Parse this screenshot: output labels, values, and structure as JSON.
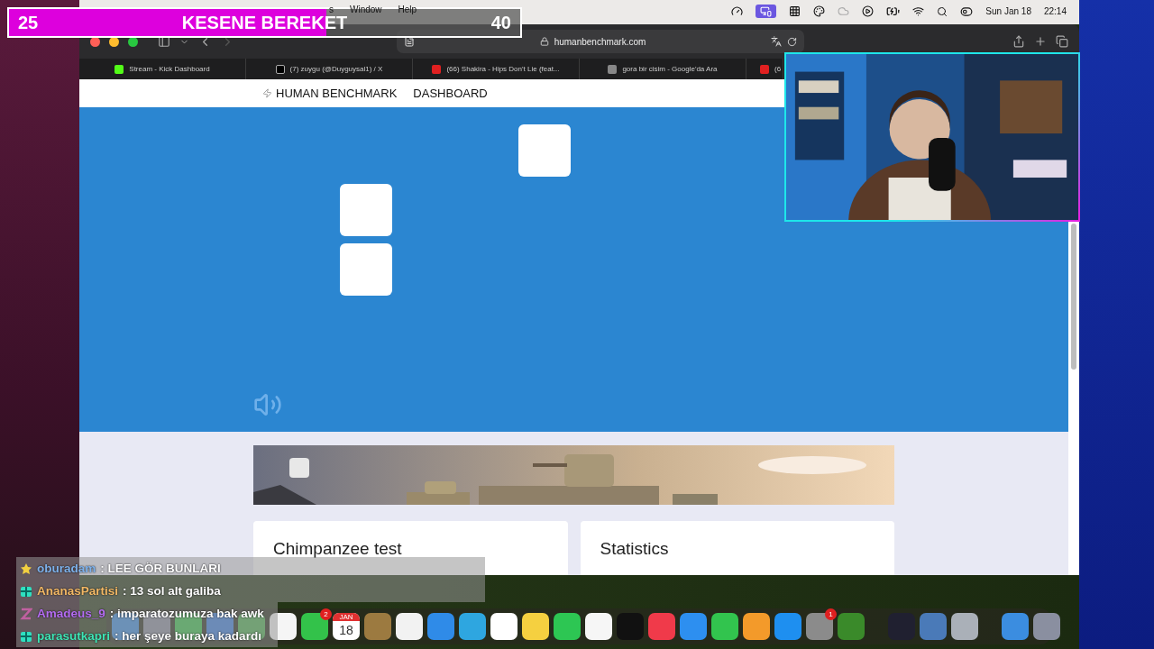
{
  "goal_bar": {
    "start": "25",
    "title": "KESENE BEREKET",
    "target": "40",
    "level": 0.62
  },
  "menu_bar": {
    "menus": [
      "s",
      "Window",
      "Help"
    ],
    "date": "Sun Jan 18",
    "time": "22:14"
  },
  "browser": {
    "address": "humanbenchmark.com",
    "tabs": [
      {
        "kind": "kick",
        "title": "Stream - Kick Dashboard"
      },
      {
        "kind": "x",
        "title": "(7) zuygu (@Duyguysal1) / X"
      },
      {
        "kind": "youtube",
        "title": "(66) Shakira - Hips Don't Lie (feat..."
      },
      {
        "kind": "google",
        "title": "gora bir cisim - Google'da Ara"
      },
      {
        "kind": "youtube",
        "title": "(6"
      }
    ]
  },
  "site": {
    "logo": "HUMAN BENCHMARK",
    "nav": [
      "DASHBOARD"
    ]
  },
  "game": {
    "tiles": [
      {
        "kind": "blank"
      },
      {
        "kind": "blank"
      },
      {
        "kind": "blank"
      }
    ]
  },
  "cards": [
    {
      "title": "Chimpanzee test"
    },
    {
      "title": "Statistics"
    }
  ],
  "chat": [
    {
      "kind": "star",
      "user": "oburadam",
      "color": "#7eb1ea",
      "message": ": LEE GÖR BUNLARI"
    },
    {
      "kind": "gift",
      "user": "AnanasPartisi",
      "color": "#f2b865",
      "message": ": 13 sol alt galiba"
    },
    {
      "kind": "zigzag",
      "user": "Amadeus_9",
      "color": "#b46cf2",
      "message": ": imparatozumuza bak awk"
    },
    {
      "kind": "gift",
      "user": "parasutkapri",
      "color": "#3ee6b6",
      "message": ": her şeye buraya kadardı"
    }
  ],
  "dock": [
    {
      "kind": "app"
    },
    {
      "kind": "app"
    },
    {
      "kind": "app"
    },
    {
      "kind": "app"
    },
    {
      "kind": "app"
    },
    {
      "kind": "app"
    },
    {
      "kind": "app",
      "badge": "2"
    },
    {
      "kind": "calendar",
      "month": "JAN",
      "day": "18"
    },
    {
      "kind": "app"
    },
    {
      "kind": "app"
    },
    {
      "kind": "app"
    },
    {
      "kind": "app"
    },
    {
      "kind": "app"
    },
    {
      "kind": "app"
    },
    {
      "kind": "app"
    },
    {
      "kind": "app"
    },
    {
      "kind": "app"
    },
    {
      "kind": "app"
    },
    {
      "kind": "app"
    },
    {
      "kind": "app"
    },
    {
      "kind": "app"
    },
    {
      "kind": "app"
    },
    {
      "kind": "app",
      "badge": "1"
    },
    {
      "kind": "app"
    },
    {
      "kind": "separator"
    },
    {
      "kind": "app"
    },
    {
      "kind": "app"
    },
    {
      "kind": "app"
    },
    {
      "kind": "separator"
    },
    {
      "kind": "app"
    },
    {
      "kind": "app"
    }
  ]
}
